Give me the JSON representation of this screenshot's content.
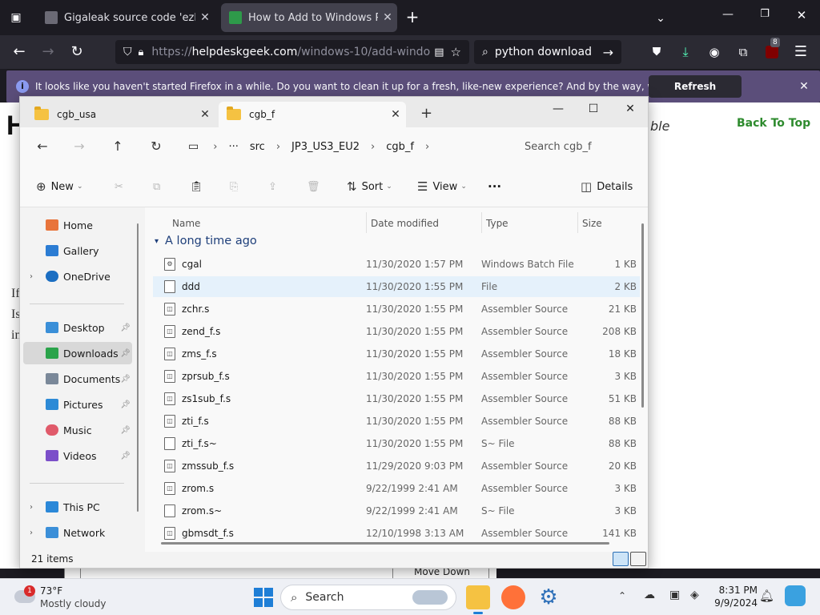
{
  "firefox": {
    "tabs": [
      {
        "title": "Gigaleak source code 'ezbuild.",
        "active": false
      },
      {
        "title": "How to Add to Windows PATH",
        "active": true
      }
    ],
    "url": {
      "prefix": "https://",
      "host": "helpdeskgeek.com",
      "path": "/windows-10/add-windo"
    },
    "search_query": "python download",
    "extensions_badge": "8",
    "notification": {
      "text": "It looks like you haven't started Firefox in a while. Do you want to clean it up for a fresh, like-new experience? And by the way, welcome back!",
      "button": "Refresh Firefox..."
    }
  },
  "webpage": {
    "back_to_top": "Back To Top",
    "partial_italic": "ble",
    "move_down": "Move Down",
    "left_fragments": [
      "H",
      "If",
      "Is",
      "in"
    ]
  },
  "explorer": {
    "tabs": [
      "cgb_usa",
      "cgb_f"
    ],
    "breadcrumb": [
      "src",
      "JP3_US3_EU2",
      "cgb_f"
    ],
    "search_placeholder": "Search cgb_f",
    "commands": {
      "new": "New",
      "sort": "Sort",
      "view": "View",
      "details": "Details"
    },
    "sidebar": [
      {
        "label": "Home",
        "icon": "home-icon",
        "color": "#e8743b"
      },
      {
        "label": "Gallery",
        "icon": "gallery-icon",
        "color": "#2b7cd3"
      },
      {
        "label": "OneDrive",
        "icon": "onedrive-icon",
        "color": "#1b6ec2"
      },
      {
        "label": "Desktop",
        "icon": "desktop-icon",
        "color": "#3a8fd8"
      },
      {
        "label": "Downloads",
        "icon": "downloads-icon",
        "color": "#2aa34a"
      },
      {
        "label": "Documents",
        "icon": "documents-icon",
        "color": "#7a8899"
      },
      {
        "label": "Pictures",
        "icon": "pictures-icon",
        "color": "#2d8ad6"
      },
      {
        "label": "Music",
        "icon": "music-icon",
        "color": "#e05a6a"
      },
      {
        "label": "Videos",
        "icon": "videos-icon",
        "color": "#7b4fc9"
      },
      {
        "label": "This PC",
        "icon": "this-pc-icon",
        "color": "#2b88d8"
      },
      {
        "label": "Network",
        "icon": "network-icon",
        "color": "#3b8fd8"
      }
    ],
    "columns": {
      "name": "Name",
      "date": "Date modified",
      "type": "Type",
      "size": "Size"
    },
    "group": "A long time ago",
    "files": [
      {
        "name": "cgal",
        "date": "11/30/2020 1:57 PM",
        "type": "Windows Batch File",
        "size": "1 KB"
      },
      {
        "name": "ddd",
        "date": "11/30/2020 1:55 PM",
        "type": "File",
        "size": "2 KB"
      },
      {
        "name": "zchr.s",
        "date": "11/30/2020 1:55 PM",
        "type": "Assembler Source",
        "size": "21 KB"
      },
      {
        "name": "zend_f.s",
        "date": "11/30/2020 1:55 PM",
        "type": "Assembler Source",
        "size": "208 KB"
      },
      {
        "name": "zms_f.s",
        "date": "11/30/2020 1:55 PM",
        "type": "Assembler Source",
        "size": "18 KB"
      },
      {
        "name": "zprsub_f.s",
        "date": "11/30/2020 1:55 PM",
        "type": "Assembler Source",
        "size": "3 KB"
      },
      {
        "name": "zs1sub_f.s",
        "date": "11/30/2020 1:55 PM",
        "type": "Assembler Source",
        "size": "51 KB"
      },
      {
        "name": "zti_f.s",
        "date": "11/30/2020 1:55 PM",
        "type": "Assembler Source",
        "size": "88 KB"
      },
      {
        "name": "zti_f.s~",
        "date": "11/30/2020 1:55 PM",
        "type": "S~ File",
        "size": "88 KB"
      },
      {
        "name": "zmssub_f.s",
        "date": "11/29/2020 9:03 PM",
        "type": "Assembler Source",
        "size": "20 KB"
      },
      {
        "name": "zrom.s",
        "date": "9/22/1999 2:41 AM",
        "type": "Assembler Source",
        "size": "3 KB"
      },
      {
        "name": "zrom.s~",
        "date": "9/22/1999 2:41 AM",
        "type": "S~ File",
        "size": "3 KB"
      },
      {
        "name": "gbmsdt_f.s",
        "date": "12/10/1998 3:13 AM",
        "type": "Assembler Source",
        "size": "141 KB"
      }
    ],
    "status": "21 items"
  },
  "taskbar": {
    "weather_badge": "1",
    "temperature": "73°F",
    "condition": "Mostly cloudy",
    "search": "Search",
    "time": "8:31 PM",
    "date": "9/9/2024"
  }
}
